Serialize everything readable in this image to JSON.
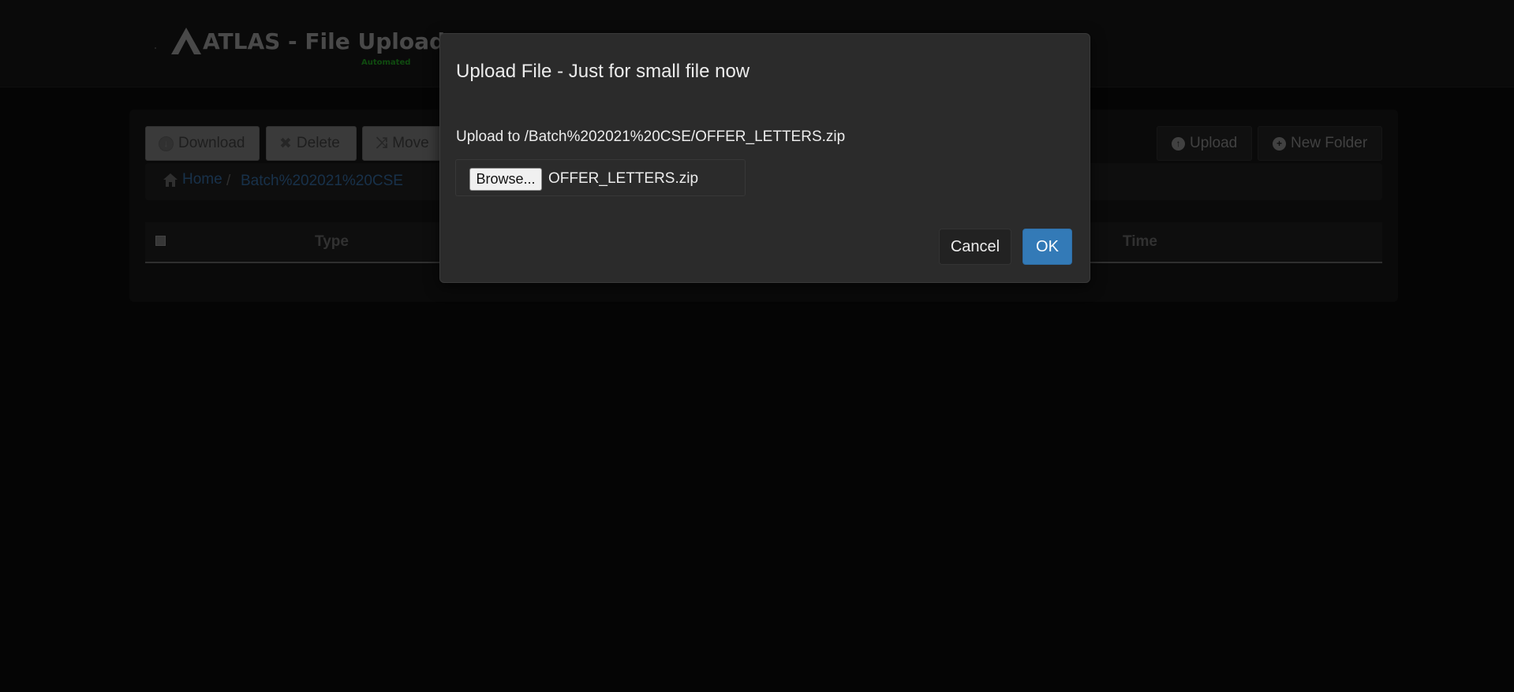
{
  "header": {
    "title": "ATLAS - File Upload Pa",
    "subtitle": "Automated",
    "logo_icon": "atlas-a-logo"
  },
  "toolbar": {
    "download_label": "Download",
    "delete_label": "Delete",
    "move_label": "Move",
    "upload_label": "Upload",
    "new_folder_label": "New Folder",
    "download_icon": "arrow-down-circle-icon",
    "delete_icon": "x-icon",
    "move_icon": "shuffle-icon",
    "upload_icon": "arrow-up-circle-icon",
    "new_folder_icon": "plus-circle-icon"
  },
  "breadcrumb": {
    "home_label": "Home",
    "separator": "/",
    "current": "Batch%202021%20CSE"
  },
  "table": {
    "columns": [
      "Type",
      "Time"
    ]
  },
  "modal": {
    "title": "Upload File - Just for small file now",
    "path_text": "Upload to /Batch%202021%20CSE/OFFER_LETTERS.zip",
    "browse_label": "Browse...",
    "file_name": "OFFER_LETTERS.zip",
    "cancel_label": "Cancel",
    "ok_label": "OK"
  },
  "colors": {
    "ok_button": "#337ab7",
    "link": "#2f5f8f",
    "brand_sub": "#1e8f1e",
    "background": "#0a0a0a"
  }
}
